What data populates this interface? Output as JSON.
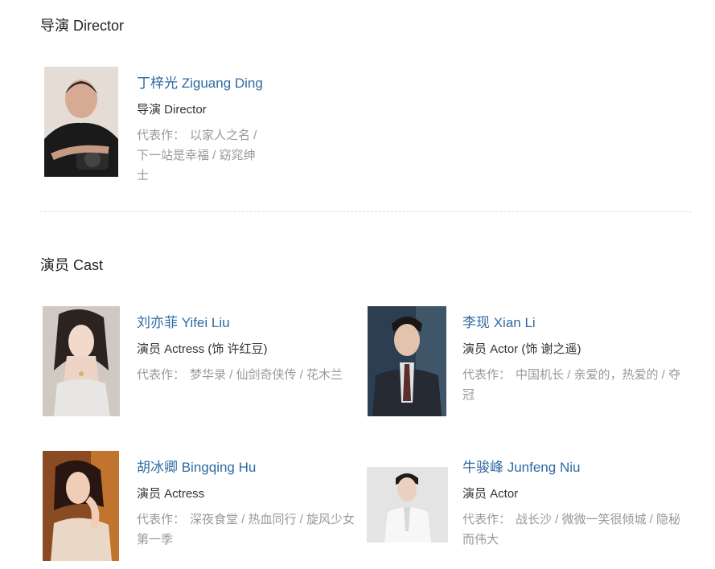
{
  "director_section": {
    "title": "导演 Director",
    "people": [
      {
        "name": "丁梓光 Ziguang Ding",
        "role": "导演 Director",
        "works_label": "代表作：",
        "works": "以家人之名 / 下一站是幸福 / 窈窕绅士"
      }
    ]
  },
  "cast_section": {
    "title": "演员 Cast",
    "people": [
      {
        "name": "刘亦菲 Yifei Liu",
        "role": "演员 Actress (饰 许红豆)",
        "works_label": "代表作：",
        "works": "梦华录 / 仙剑奇侠传 / 花木兰"
      },
      {
        "name": "李现 Xian Li",
        "role": "演员 Actor (饰 谢之遥)",
        "works_label": "代表作：",
        "works": "中国机长 / 亲爱的，热爱的 / 夺冠"
      },
      {
        "name": "胡冰卿 Bingqing Hu",
        "role": "演员 Actress",
        "works_label": "代表作：",
        "works": "深夜食堂 / 热血同行 / 旋风少女第一季"
      },
      {
        "name": "牛骏峰 Junfeng Niu",
        "role": "演员 Actor",
        "works_label": "代表作：",
        "works": "战长沙 / 微微一笑很倾城 / 隐秘而伟大"
      }
    ]
  },
  "colors": {
    "name_link": "#2e6aa3",
    "works_text": "#999999",
    "divider": "#dddddd"
  }
}
